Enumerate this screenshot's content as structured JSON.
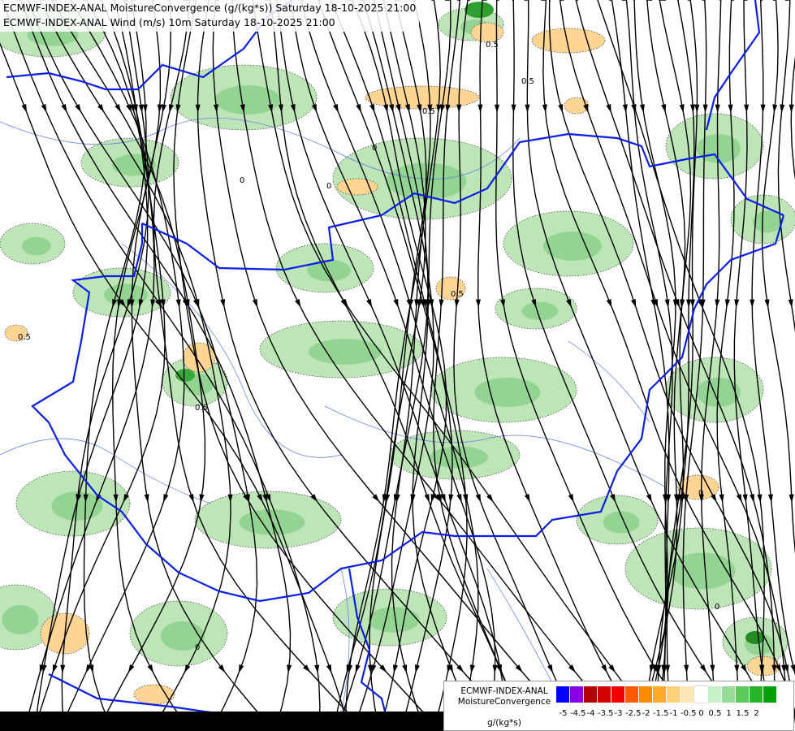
{
  "title": {
    "line1": "ECMWF-INDEX-ANAL MoistureConvergence (g/(kg*s)) Saturday 18-10-2025 21:00",
    "line2": "ECMWF-INDEX-ANAL Wind (m/s) 10m Saturday 18-10-2025 21:00"
  },
  "legend": {
    "line1": "ECMWF-INDEX-ANAL",
    "line2": "MoistureConvergence",
    "unit": "g/(kg*s)",
    "colors": [
      "#0000ff",
      "#8a00e6",
      "#b40000",
      "#d20000",
      "#f00000",
      "#ff5a00",
      "#ff8c00",
      "#ffaa28",
      "#ffd27a",
      "#ffe6b4",
      "#ffffff",
      "#c8f0c8",
      "#96dc96",
      "#5ac85a",
      "#28b428",
      "#00a000"
    ],
    "ticks": [
      "-5",
      "-4.5",
      "-4",
      "-3.5",
      "-3",
      "-2.5",
      "-2",
      "-1.5",
      "-1",
      "-0.5",
      "0",
      "0.5",
      "1",
      "1.5",
      "2"
    ]
  },
  "contour_labels": [
    "0",
    "0.5",
    "0",
    "0.5",
    "0",
    "0.5",
    "0",
    "0.5",
    "0",
    "0.5",
    "0",
    "0.5"
  ]
}
